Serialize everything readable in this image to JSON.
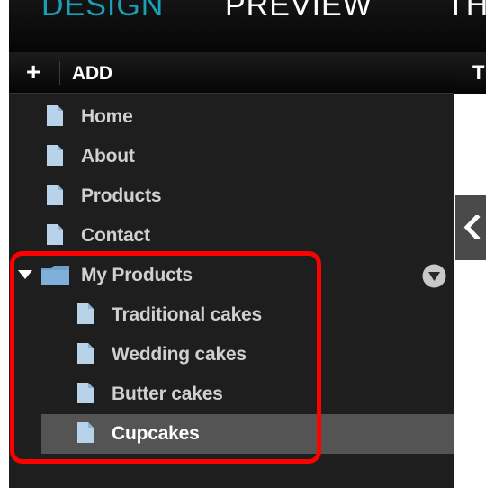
{
  "app": {
    "top_tabs": [
      "DESIGN",
      "PREVIEW",
      "THE"
    ]
  },
  "sidebar": {
    "add_label": "ADD",
    "items": [
      {
        "label": "Home",
        "type": "page"
      },
      {
        "label": "About",
        "type": "page"
      },
      {
        "label": "Products",
        "type": "page"
      },
      {
        "label": "Contact",
        "type": "page"
      },
      {
        "label": "My Products",
        "type": "folder",
        "expanded": true
      },
      {
        "label": "Traditional cakes",
        "type": "page",
        "level": 1
      },
      {
        "label": "Wedding cakes",
        "type": "page",
        "level": 1
      },
      {
        "label": "Butter cakes",
        "type": "page",
        "level": 1
      },
      {
        "label": "Cupcakes",
        "type": "page",
        "level": 1,
        "selected": true
      }
    ]
  },
  "content": {
    "header_text": "T"
  },
  "colors": {
    "accent_design_tab": "#1aa0b6",
    "sidebar_background": "#1e1e1e",
    "selected_row": "#545454",
    "page_icon": "#b8d2ea",
    "folder_icon": "#6f9fca",
    "highlight_box": "#ff0000"
  },
  "icons": {
    "add": "plus-icon",
    "page": "page-icon",
    "folder": "folder-icon",
    "expanded": "triangle-down-icon",
    "folder_menu": "dropdown-circle-icon",
    "collapse": "chevron-left-icon"
  }
}
